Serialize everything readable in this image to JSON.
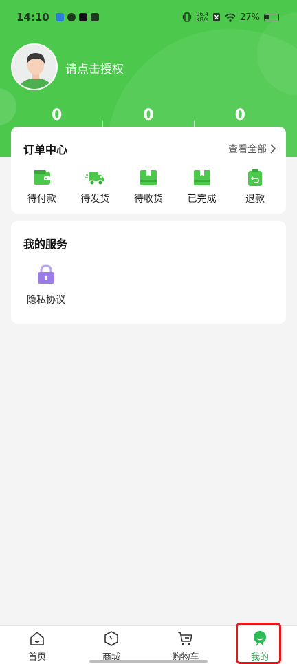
{
  "status_bar": {
    "time": "14:10",
    "net_speed_value": "96.4",
    "net_speed_unit": "KB/s",
    "battery": "27%"
  },
  "profile": {
    "login_prompt": "请点击授权",
    "stats": [
      "0",
      "0",
      "0"
    ]
  },
  "orders": {
    "title": "订单中心",
    "view_all": "查看全部",
    "items": [
      {
        "label": "待付款",
        "icon": "wallet-icon"
      },
      {
        "label": "待发货",
        "icon": "truck-icon"
      },
      {
        "label": "待收货",
        "icon": "box-icon"
      },
      {
        "label": "已完成",
        "icon": "box-done-icon"
      },
      {
        "label": "退款",
        "icon": "refund-icon"
      }
    ]
  },
  "services": {
    "title": "我的服务",
    "items": [
      {
        "label": "隐私协议",
        "icon": "lock-icon"
      }
    ]
  },
  "tabbar": {
    "items": [
      {
        "label": "首页",
        "icon": "home-icon"
      },
      {
        "label": "商城",
        "icon": "mall-icon"
      },
      {
        "label": "购物车",
        "icon": "cart-icon"
      },
      {
        "label": "我的",
        "icon": "profile-icon",
        "active": true
      }
    ]
  },
  "colors": {
    "brand_green": "#4cc94c",
    "active_tab": "#2dbb55",
    "lock_purple": "#9b7be8",
    "highlight_red": "#e01a1a"
  }
}
